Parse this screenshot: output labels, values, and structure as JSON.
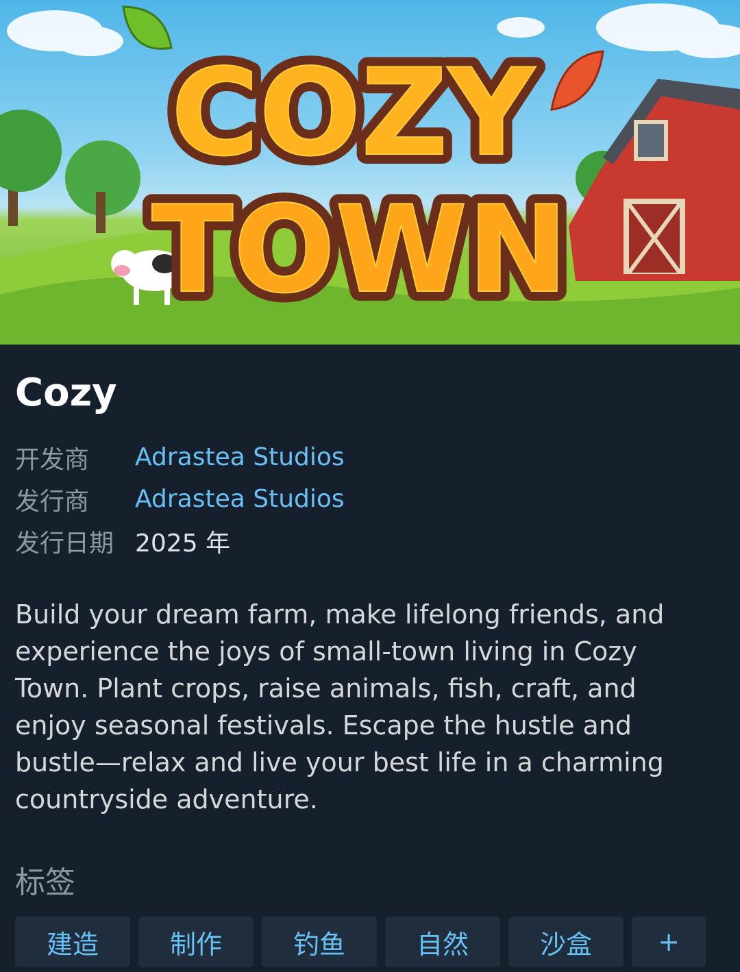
{
  "hero": {
    "logo_line1": "COZY",
    "logo_line2": "TOWN"
  },
  "game": {
    "title": "Cozy"
  },
  "meta": [
    {
      "label": "开发商",
      "value": "Adrastea Studios",
      "is_link": true
    },
    {
      "label": "发行商",
      "value": "Adrastea Studios",
      "is_link": true
    },
    {
      "label": "发行日期",
      "value": "2025 年",
      "is_link": false
    }
  ],
  "description": "Build your dream farm, make lifelong friends, and experience the joys of small-town living in Cozy Town. Plant crops, raise animals, fish, craft, and enjoy seasonal festivals. Escape the hustle and bustle—relax and live your best life in a charming countryside adventure.",
  "tags": {
    "title": "标签",
    "items": [
      "建造",
      "制作",
      "钓鱼",
      "自然",
      "沙盒"
    ],
    "more": "+"
  },
  "colors": {
    "background": "#16202d",
    "link": "#67c1f5",
    "label": "#8f98a0",
    "tag_bg": "#202d3d"
  }
}
